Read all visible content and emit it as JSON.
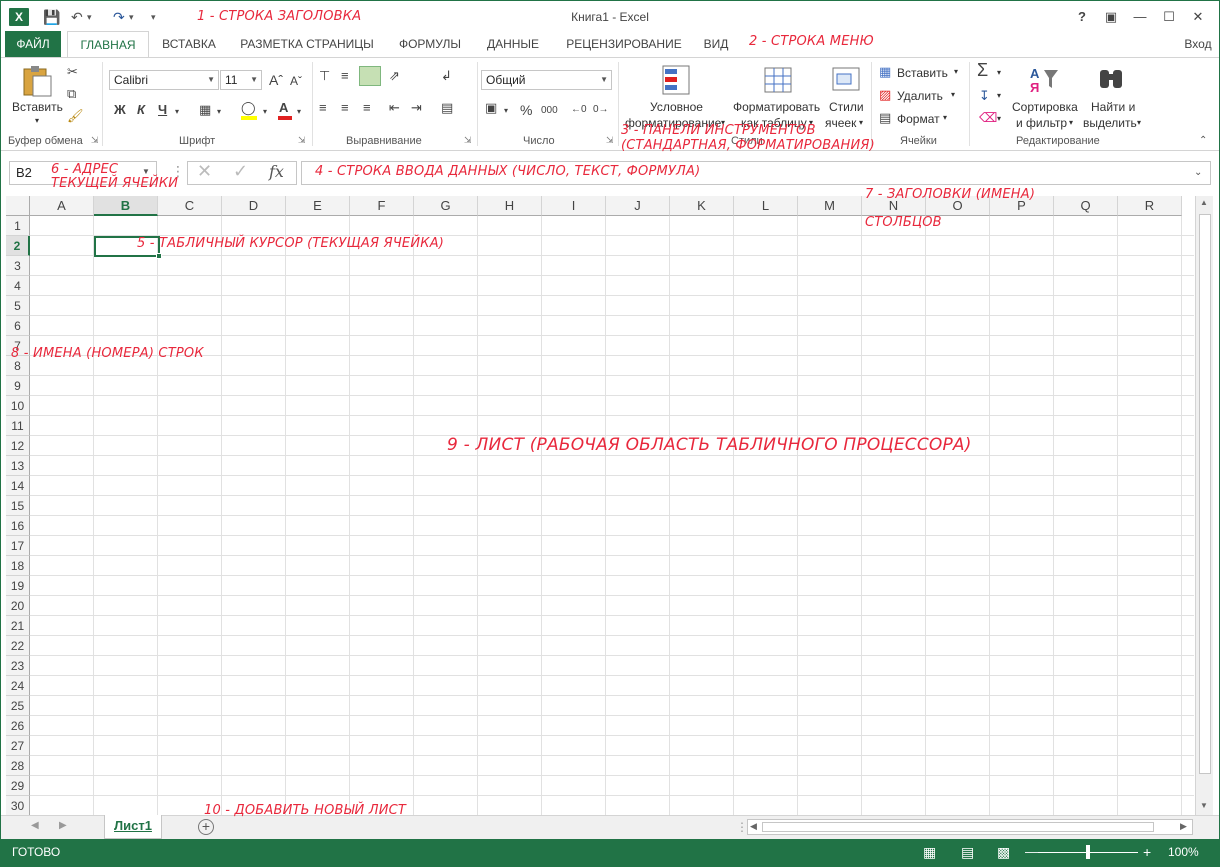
{
  "window": {
    "title": "Книга1 - Excel",
    "logo": "X",
    "login": "Вход"
  },
  "tabs": [
    "ФАЙЛ",
    "ГЛАВНАЯ",
    "ВСТАВКА",
    "РАЗМЕТКА СТРАНИЦЫ",
    "ФОРМУЛЫ",
    "ДАННЫЕ",
    "РЕЦЕНЗИРОВАНИЕ",
    "ВИД"
  ],
  "ribbon": {
    "clipboard": {
      "paste": "Вставить",
      "label": "Буфер обмена"
    },
    "font": {
      "name": "Calibri",
      "size": "11",
      "bold": "Ж",
      "italic": "К",
      "underline": "Ч",
      "label": "Шрифт"
    },
    "alignment": {
      "label": "Выравнивание"
    },
    "number": {
      "format": "Общий",
      "percent": "%",
      "thousands": "000",
      "label": "Число"
    },
    "styles": {
      "conditional_1": "Условное",
      "conditional_2": "форматирование",
      "as_table_1": "Форматировать",
      "as_table_2": "как таблицу",
      "cell_styles_1": "Стили",
      "cell_styles_2": "ячеек",
      "label": "Стили"
    },
    "cells": {
      "insert": "Вставить",
      "delete": "Удалить",
      "format": "Формат",
      "label": "Ячейки"
    },
    "editing": {
      "sort_1": "Сортировка",
      "sort_2": "и фильтр",
      "find_1": "Найти и",
      "find_2": "выделить",
      "label": "Редактирование"
    }
  },
  "formula_bar": {
    "name_box": "B2",
    "fx": "fx"
  },
  "columns": [
    "A",
    "B",
    "C",
    "D",
    "E",
    "F",
    "G",
    "H",
    "I",
    "J",
    "K",
    "L",
    "M",
    "N",
    "O",
    "P",
    "Q",
    "R"
  ],
  "rows": [
    "1",
    "2",
    "3",
    "4",
    "5",
    "6",
    "7",
    "8",
    "9",
    "10",
    "11",
    "12",
    "13",
    "14",
    "15",
    "16",
    "17",
    "18",
    "19",
    "20",
    "21",
    "22",
    "23",
    "24",
    "25",
    "26",
    "27",
    "28",
    "29",
    "30"
  ],
  "selected": {
    "column": "B",
    "row": "2"
  },
  "sheet": {
    "tab": "Лист1"
  },
  "status": {
    "ready": "ГОТОВО",
    "zoom": "100%",
    "zoom_level": 100
  },
  "annotations": {
    "a1": "1 - строка заголовка",
    "a2": "2 - строка меню",
    "a3_1": "3 - панели инструментов",
    "a3_2": "(стандартная, форматирования)",
    "a4": "4 - строка ввода данных (число, текст, формула)",
    "a5": "5 - табличный курсор (текущая ячейка)",
    "a6_1": "6 - адрес",
    "a6_2": "текущей ячейки",
    "a7_1": "7 - заголовки (имена)",
    "a7_2": "столбцов",
    "a8": "8 - имена (номера) строк",
    "a9": "9 - лист (рабочая область табличного процессора)",
    "a10": "10 - добавить новый лист"
  }
}
